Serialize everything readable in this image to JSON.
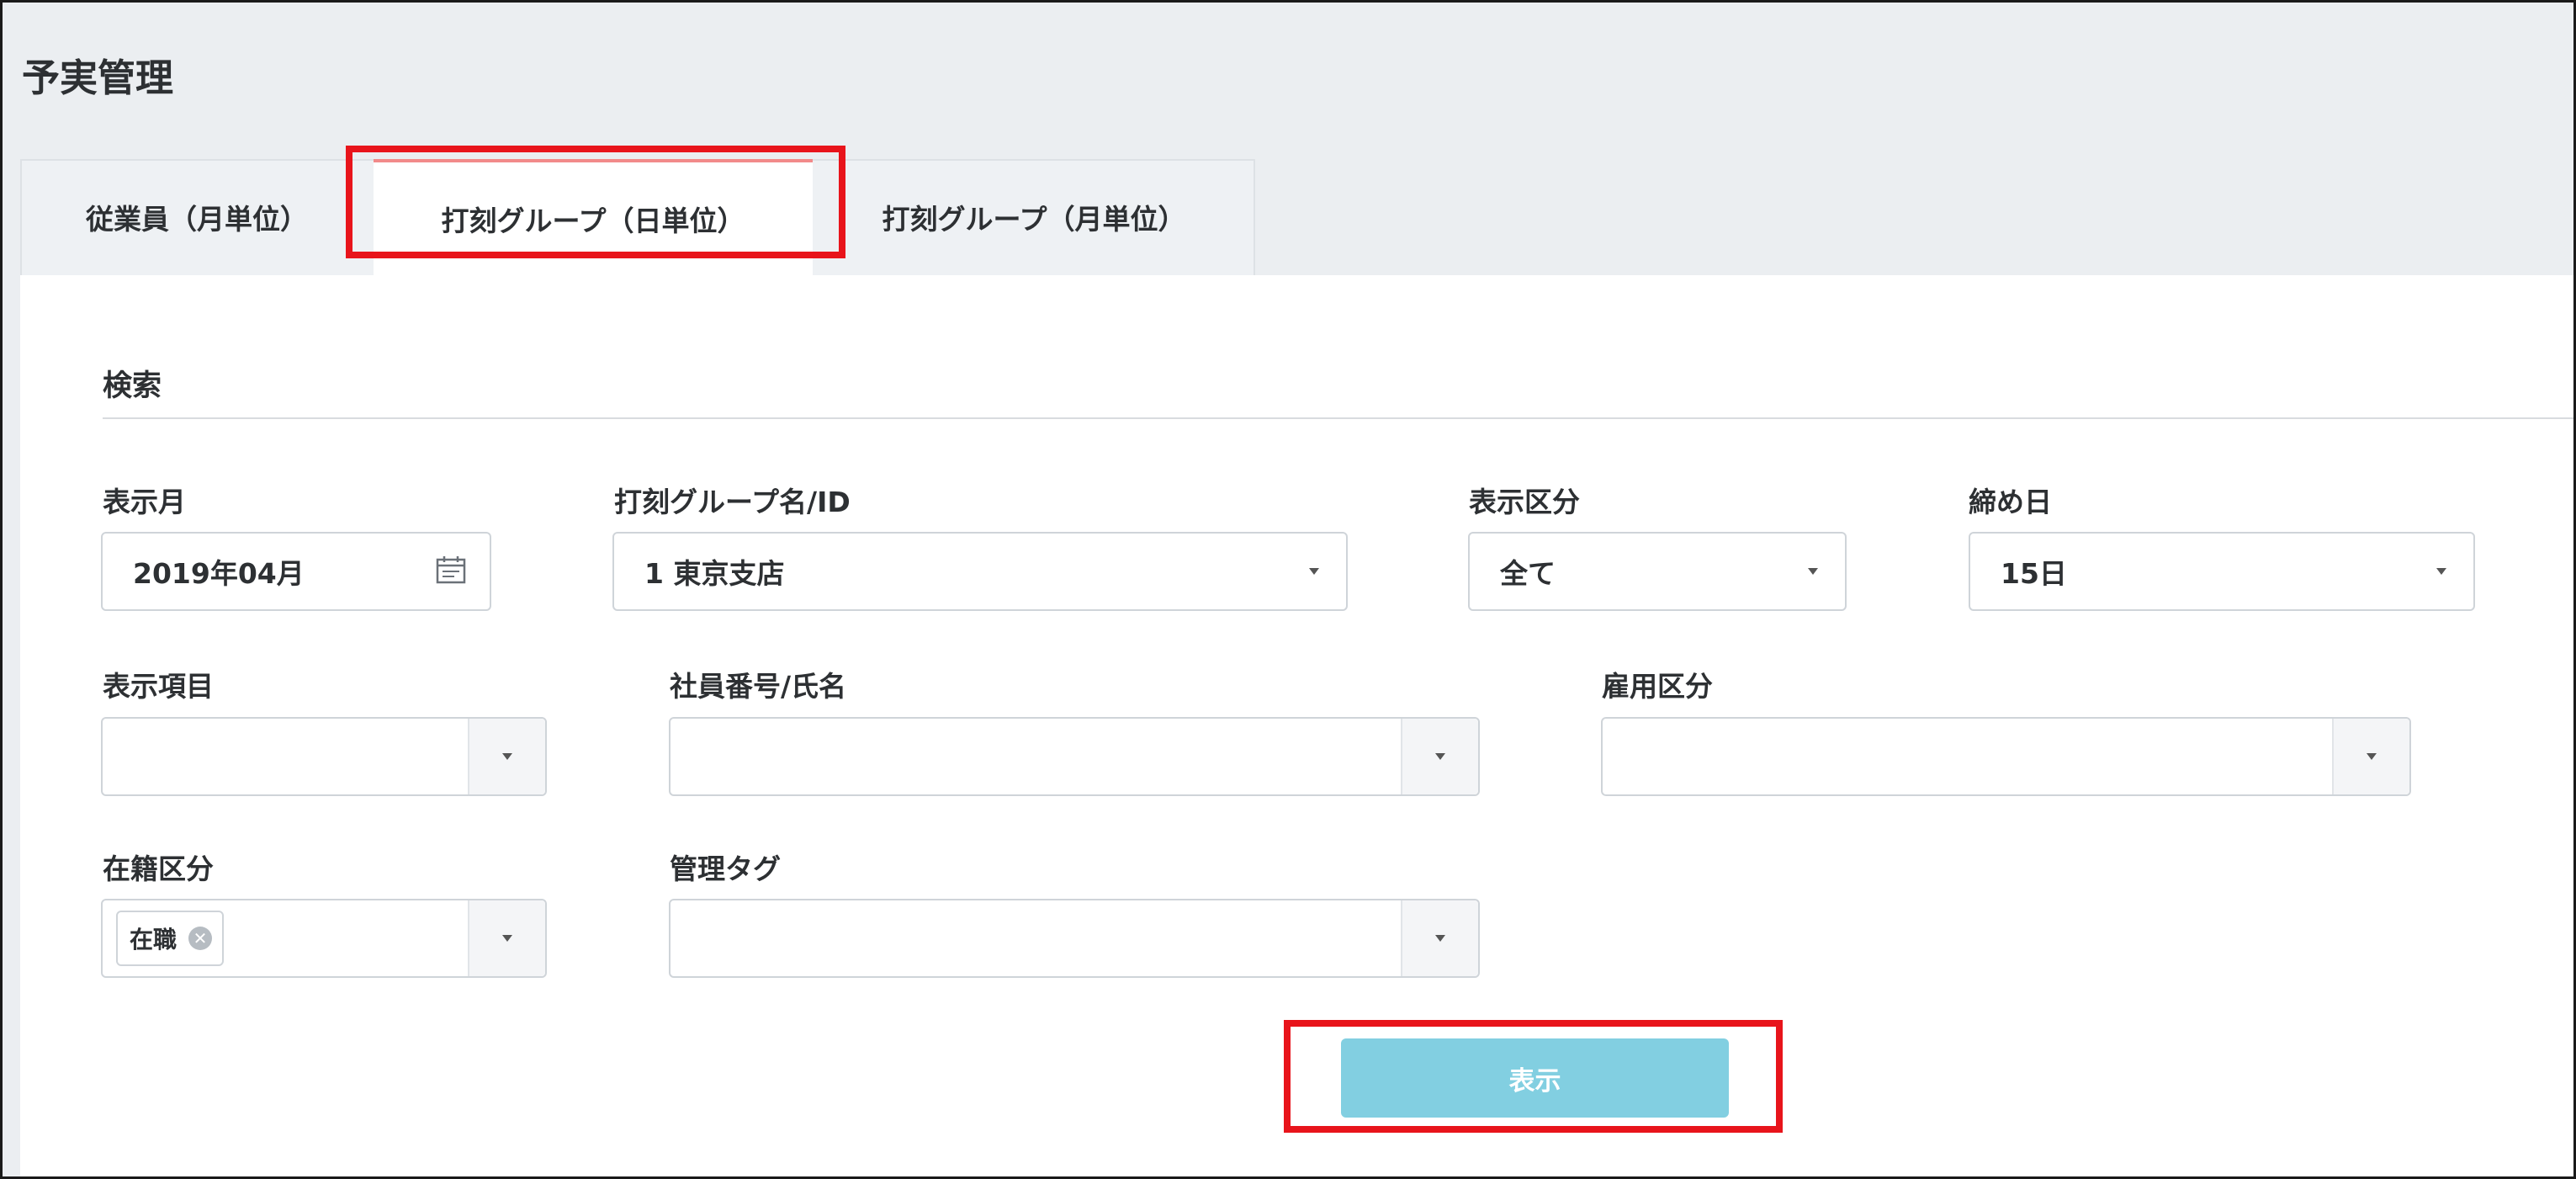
{
  "page": {
    "title": "予実管理"
  },
  "tabs": [
    {
      "label": "従業員（月単位）",
      "active": false
    },
    {
      "label": "打刻グループ（日単位）",
      "active": true
    },
    {
      "label": "打刻グループ（月単位）",
      "active": false
    }
  ],
  "search": {
    "title": "検索",
    "display_month": {
      "label": "表示月",
      "value": "2019年04月",
      "icon": "calendar-icon"
    },
    "group": {
      "label": "打刻グループ名/ID",
      "value": "1 東京支店"
    },
    "display_category": {
      "label": "表示区分",
      "value": "全て"
    },
    "closing_day": {
      "label": "締め日",
      "value": "15日"
    },
    "display_items": {
      "label": "表示項目",
      "value": ""
    },
    "employee": {
      "label": "社員番号/氏名",
      "value": ""
    },
    "employment_type": {
      "label": "雇用区分",
      "value": ""
    },
    "enrollment": {
      "label": "在籍区分",
      "chips": [
        "在職"
      ]
    },
    "management_tag": {
      "label": "管理タグ",
      "value": ""
    },
    "submit_label": "表示"
  },
  "colors": {
    "accent": "#82cfe1",
    "highlight": "#e8141b",
    "active_tab_top": "#f28a8a"
  }
}
